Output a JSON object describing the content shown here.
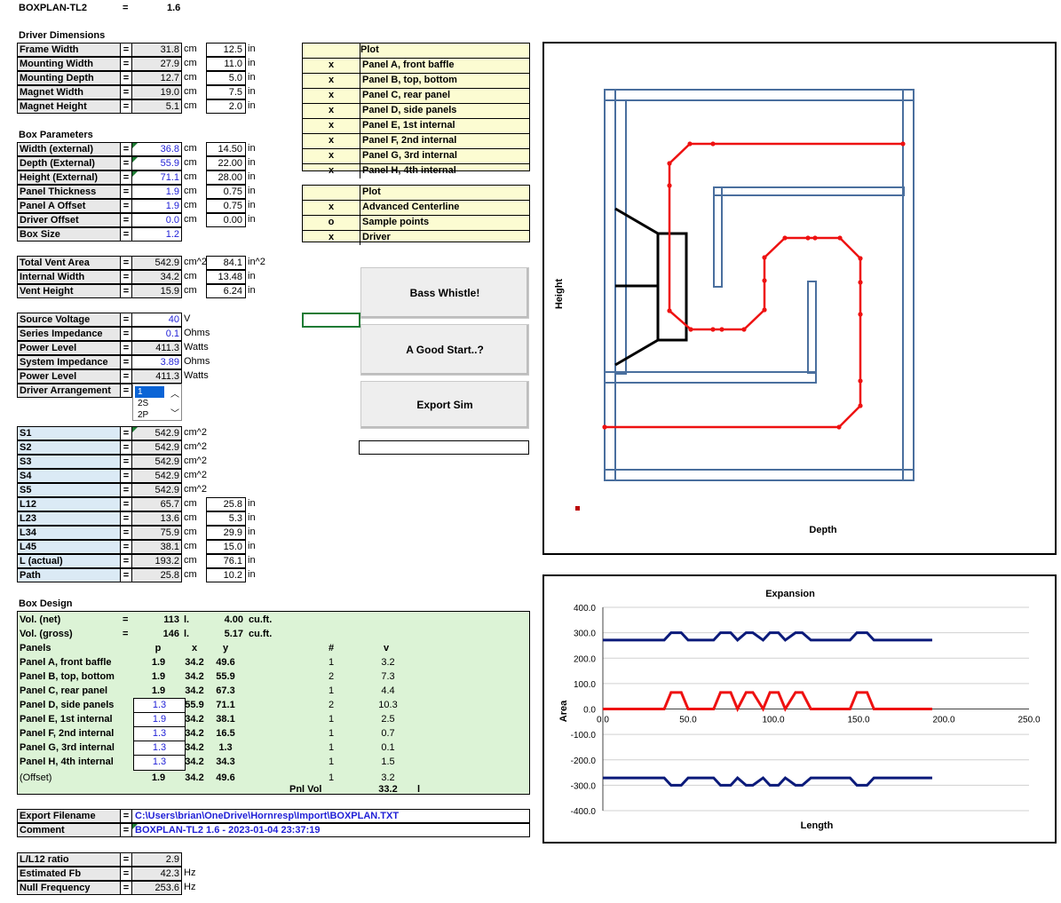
{
  "header": {
    "name": "BOXPLAN-TL2",
    "eq": "=",
    "version": "1.6"
  },
  "driver_dimensions": {
    "title": "Driver Dimensions",
    "rows": [
      {
        "label": "Frame Width",
        "cm": "31.8",
        "unit_cm": "cm",
        "inch": "12.5",
        "unit_in": "in"
      },
      {
        "label": "Mounting Width",
        "cm": "27.9",
        "unit_cm": "cm",
        "inch": "11.0",
        "unit_in": "in"
      },
      {
        "label": "Mounting Depth",
        "cm": "12.7",
        "unit_cm": "cm",
        "inch": "5.0",
        "unit_in": "in"
      },
      {
        "label": "Magnet Width",
        "cm": "19.0",
        "unit_cm": "cm",
        "inch": "7.5",
        "unit_in": "in"
      },
      {
        "label": "Magnet Height",
        "cm": "5.1",
        "unit_cm": "cm",
        "inch": "2.0",
        "unit_in": "in"
      }
    ]
  },
  "box_parameters": {
    "title": "Box Parameters",
    "rows": [
      {
        "label": "Width (external)",
        "cm": "36.8",
        "unit_cm": "cm",
        "inch": "14.50",
        "unit_in": "in"
      },
      {
        "label": "Depth (External)",
        "cm": "55.9",
        "unit_cm": "cm",
        "inch": "22.00",
        "unit_in": "in"
      },
      {
        "label": "Height (External)",
        "cm": "71.1",
        "unit_cm": "cm",
        "inch": "28.00",
        "unit_in": "in"
      },
      {
        "label": "Panel Thickness",
        "cm": "1.9",
        "unit_cm": "cm",
        "inch": "0.75",
        "unit_in": "in"
      },
      {
        "label": "Panel A Offset",
        "cm": "1.9",
        "unit_cm": "cm",
        "inch": "0.75",
        "unit_in": "in"
      },
      {
        "label": "Driver Offset",
        "cm": "0.0",
        "unit_cm": "cm",
        "inch": "0.00",
        "unit_in": "in"
      },
      {
        "label": "Box Size",
        "cm": "1.2"
      }
    ]
  },
  "vent": {
    "rows": [
      {
        "label": "Total Vent Area",
        "cm": "542.9",
        "unit_cm": "cm^2",
        "inch": "84.1",
        "unit_in": "in^2"
      },
      {
        "label": "Internal Width",
        "cm": "34.2",
        "unit_cm": "cm",
        "inch": "13.48",
        "unit_in": "in"
      },
      {
        "label": "Vent Height",
        "cm": "15.9",
        "unit_cm": "cm",
        "inch": "6.24",
        "unit_in": "in"
      }
    ]
  },
  "power": {
    "rows": [
      {
        "label": "Source Voltage",
        "val": "40",
        "unit": "V"
      },
      {
        "label": "Series Impedance",
        "val": "0.1",
        "unit": "Ohms"
      },
      {
        "label": "Power Level",
        "val": "411.3",
        "unit": "Watts"
      },
      {
        "label": "System Impedance",
        "val": "3.89",
        "unit": "Ohms"
      },
      {
        "label": "Power Level",
        "val": "411.3",
        "unit": "Watts"
      }
    ],
    "arrangement_label": "Driver Arrangement",
    "arrangement_options": [
      "1",
      "2S",
      "2P"
    ]
  },
  "sections": {
    "rows": [
      {
        "label": "S1",
        "val": "542.9",
        "unit": "cm^2"
      },
      {
        "label": "S2",
        "val": "542.9",
        "unit": "cm^2"
      },
      {
        "label": "S3",
        "val": "542.9",
        "unit": "cm^2"
      },
      {
        "label": "S4",
        "val": "542.9",
        "unit": "cm^2"
      },
      {
        "label": "S5",
        "val": "542.9",
        "unit": "cm^2"
      },
      {
        "label": "L12",
        "val": "65.7",
        "unit": "cm",
        "inch": "25.8",
        "unit_in": "in"
      },
      {
        "label": "L23",
        "val": "13.6",
        "unit": "cm",
        "inch": "5.3",
        "unit_in": "in"
      },
      {
        "label": "L34",
        "val": "75.9",
        "unit": "cm",
        "inch": "29.9",
        "unit_in": "in"
      },
      {
        "label": "L45",
        "val": "38.1",
        "unit": "cm",
        "inch": "15.0",
        "unit_in": "in"
      },
      {
        "label": "L (actual)",
        "val": "193.2",
        "unit": "cm",
        "inch": "76.1",
        "unit_in": "in"
      },
      {
        "label": "Path",
        "val": "25.8",
        "unit": "cm",
        "inch": "10.2",
        "unit_in": "in"
      }
    ]
  },
  "box_design": {
    "title": "Box Design",
    "vol_net": {
      "label": "Vol. (net)",
      "eq": "=",
      "l": "113",
      "lu": "l.",
      "cuft": "4.00",
      "cuftu": "cu.ft."
    },
    "vol_gross": {
      "label": "Vol. (gross)",
      "eq": "=",
      "l": "146",
      "lu": "l.",
      "cuft": "5.17",
      "cuftu": "cu.ft."
    },
    "cols": {
      "name": "Panels",
      "p": "p",
      "x": "x",
      "y": "y",
      "n": "#",
      "v": "v"
    },
    "panels": [
      {
        "name": "Panel A, front baffle",
        "p": "1.9",
        "x": "34.2",
        "y": "49.6",
        "n": "1",
        "v": "3.2"
      },
      {
        "name": "Panel B, top, bottom",
        "p": "1.9",
        "x": "34.2",
        "y": "55.9",
        "n": "2",
        "v": "7.3"
      },
      {
        "name": "Panel C, rear panel",
        "p": "1.9",
        "x": "34.2",
        "y": "67.3",
        "n": "1",
        "v": "4.4"
      },
      {
        "name": "Panel D, side panels",
        "p": "1.3",
        "x": "55.9",
        "y": "71.1",
        "n": "2",
        "v": "10.3"
      },
      {
        "name": "Panel E, 1st internal",
        "p": "1.9",
        "x": "34.2",
        "y": "38.1",
        "n": "1",
        "v": "2.5"
      },
      {
        "name": "Panel F, 2nd internal",
        "p": "1.3",
        "x": "34.2",
        "y": "16.5",
        "n": "1",
        "v": "0.7"
      },
      {
        "name": "Panel G, 3rd internal",
        "p": "1.3",
        "x": "34.2",
        "y": "1.3",
        "n": "1",
        "v": "0.1"
      },
      {
        "name": "Panel H, 4th internal",
        "p": "1.3",
        "x": "34.2",
        "y": "34.3",
        "n": "1",
        "v": "1.5"
      },
      {
        "name": "(Offset)",
        "p": "1.9",
        "x": "34.2",
        "y": "49.6",
        "n": "1",
        "v": "3.2"
      }
    ],
    "pnl_vol": {
      "label": "Pnl Vol",
      "val": "33.2",
      "unit": "l"
    }
  },
  "export": {
    "filename_label": "Export Filename",
    "filename": "C:\\Users\\brian\\OneDrive\\Hornresp\\Import\\BOXPLAN.TXT",
    "comment_label": "Comment",
    "comment": "BOXPLAN-TL2 1.6 - 2023-01-04 23:37:19"
  },
  "results": {
    "rows": [
      {
        "label": "L/L12 ratio",
        "val": "2.9",
        "unit": ""
      },
      {
        "label": "Estimated Fb",
        "val": "42.3",
        "unit": "Hz"
      },
      {
        "label": "Null Frequency",
        "val": "253.6",
        "unit": "Hz"
      }
    ]
  },
  "plot_list": {
    "title": "Plot",
    "items": [
      {
        "mark": "x",
        "label": "Panel A, front baffle"
      },
      {
        "mark": "x",
        "label": "Panel B, top, bottom"
      },
      {
        "mark": "x",
        "label": "Panel C, rear panel"
      },
      {
        "mark": "x",
        "label": "Panel D, side panels"
      },
      {
        "mark": "x",
        "label": "Panel E, 1st internal"
      },
      {
        "mark": "x",
        "label": "Panel F, 2nd internal"
      },
      {
        "mark": "x",
        "label": "Panel G, 3rd internal"
      },
      {
        "mark": "x",
        "label": "Panel H, 4th internal"
      }
    ]
  },
  "plot_list2": {
    "title": "Plot",
    "items": [
      {
        "mark": "x",
        "label": "Advanced Centerline"
      },
      {
        "mark": "o",
        "label": "Sample points"
      },
      {
        "mark": "x",
        "label": "Driver"
      }
    ]
  },
  "buttons": {
    "bass": "Bass Whistle!",
    "start": "A Good Start..?",
    "export": "Export Sim"
  },
  "layout_chart": {
    "xlabel": "Depth",
    "ylabel": "Height"
  },
  "colors": {
    "panel": "#4a6f9e",
    "centerline": "#ee1111",
    "driver": "#000000",
    "upper": "#0b1a7a",
    "lower": "#0b1a7a",
    "mid": "#ee1111"
  },
  "chart_data": {
    "type": "line",
    "title": "Expansion",
    "xlabel": "Length",
    "ylabel": "Area",
    "xlim": [
      0,
      250
    ],
    "ylim": [
      -400,
      400
    ],
    "xticks": [
      "0.0",
      "50.0",
      "100.0",
      "150.0",
      "200.0",
      "250.0"
    ],
    "yticks": [
      "400.0",
      "300.0",
      "200.0",
      "100.0",
      "0.0",
      "-100.0",
      "-200.0",
      "-300.0",
      "-400.0"
    ],
    "series": [
      {
        "x": [
          0,
          36,
          40,
          46,
          50,
          65,
          69,
          75,
          79,
          84,
          88,
          94,
          98,
          103,
          107,
          113,
          117,
          122,
          126,
          145,
          149,
          155,
          159,
          193.2
        ],
        "y": [
          271,
          271,
          300,
          300,
          271,
          271,
          300,
          300,
          271,
          300,
          300,
          271,
          300,
          300,
          271,
          300,
          300,
          271,
          271,
          271,
          300,
          300,
          271,
          271
        ]
      },
      {
        "x": [
          0,
          36,
          40,
          46,
          50,
          65,
          69,
          75,
          79,
          84,
          88,
          94,
          98,
          103,
          107,
          113,
          117,
          122,
          126,
          145,
          149,
          155,
          159,
          193.2
        ],
        "y": [
          0,
          0,
          65,
          65,
          0,
          0,
          65,
          65,
          0,
          65,
          65,
          0,
          65,
          65,
          0,
          65,
          65,
          0,
          0,
          0,
          65,
          65,
          0,
          0
        ]
      },
      {
        "x": [
          0,
          36,
          40,
          46,
          50,
          65,
          69,
          75,
          79,
          84,
          88,
          94,
          98,
          103,
          107,
          113,
          117,
          122,
          126,
          145,
          149,
          155,
          159,
          193.2
        ],
        "y": [
          -271,
          -271,
          -300,
          -300,
          -271,
          -271,
          -300,
          -300,
          -271,
          -300,
          -300,
          -271,
          -300,
          -300,
          -271,
          -300,
          -300,
          -271,
          -271,
          -271,
          -300,
          -300,
          -271,
          -271
        ]
      }
    ]
  }
}
